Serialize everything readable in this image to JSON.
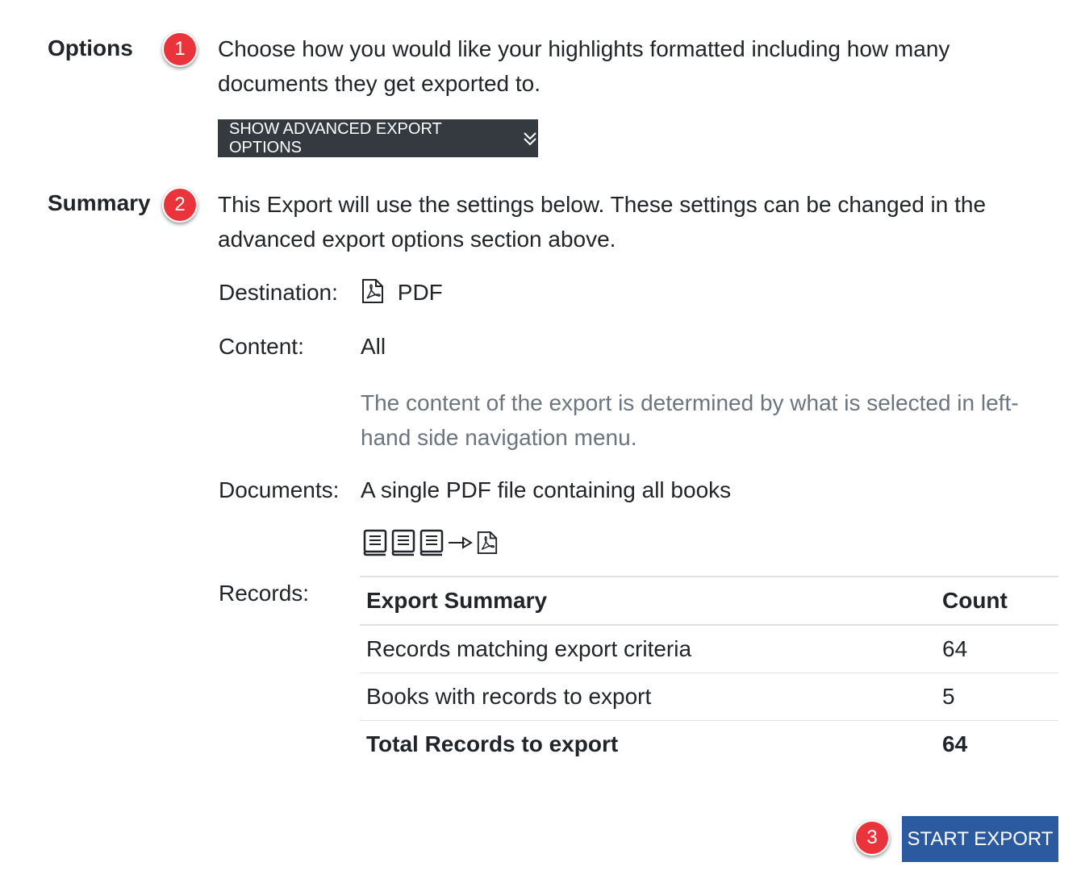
{
  "options": {
    "label": "Options",
    "badge": "1",
    "description": "Choose how you would like your highlights formatted including how many documents they get exported to.",
    "advanced_button": "SHOW ADVANCED EXPORT OPTIONS",
    "advanced_button_icon": "double-chevron-down-icon"
  },
  "summary": {
    "label": "Summary",
    "badge": "2",
    "description": "This Export will use the settings below. These settings can be changed in the advanced export options section above.",
    "destination_label": "Destination:",
    "destination_icon": "pdf-file-icon",
    "destination_value": "PDF",
    "content_label": "Content:",
    "content_value": "All",
    "content_note": "The content of the export is determined by what is selected in left-hand side navigation menu.",
    "documents_label": "Documents:",
    "documents_value": "A single PDF file containing all books",
    "documents_icons": [
      "book-icon",
      "book-icon",
      "book-icon",
      "arrow-right-icon",
      "pdf-file-icon"
    ],
    "records_label": "Records:",
    "table": {
      "headers": [
        "Export Summary",
        "Count"
      ],
      "rows": [
        {
          "label": "Records matching export criteria",
          "count": "64"
        },
        {
          "label": "Books with records to export",
          "count": "5"
        }
      ],
      "total": {
        "label": "Total Records to export",
        "count": "64"
      }
    }
  },
  "actions": {
    "badge": "3",
    "start_export": "START EXPORT"
  },
  "colors": {
    "badge": "#e8343a",
    "dark_button": "#343a40",
    "primary_button": "#2c5aa0",
    "muted_text": "#6c757d"
  }
}
